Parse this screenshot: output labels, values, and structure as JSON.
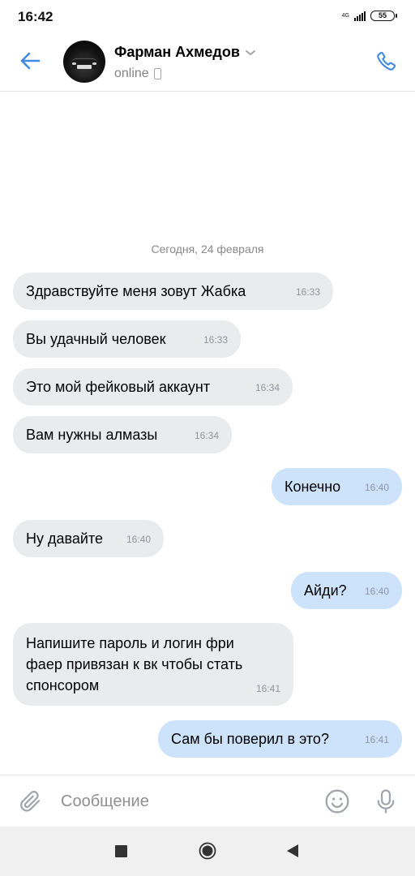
{
  "status_bar": {
    "time": "16:42",
    "network": "4G",
    "battery": "55"
  },
  "header": {
    "contact_name": "Фарман Ахмедов",
    "status": "online"
  },
  "chat": {
    "date_divider": "Сегодня, 24 февраля",
    "messages": [
      {
        "direction": "incoming",
        "text": "Здравствуйте меня зовут Жабка",
        "time": "16:33"
      },
      {
        "direction": "incoming",
        "text": "Вы удачный человек",
        "time": "16:33"
      },
      {
        "direction": "incoming",
        "text": "Это мой фейковый аккаунт",
        "time": "16:34"
      },
      {
        "direction": "incoming",
        "text": "Вам нужны алмазы",
        "time": "16:34"
      },
      {
        "direction": "outgoing",
        "text": "Конечно",
        "time": "16:40"
      },
      {
        "direction": "incoming",
        "text": "Ну давайте",
        "time": "16:40"
      },
      {
        "direction": "outgoing",
        "text": "Айди?",
        "time": "16:40"
      },
      {
        "direction": "incoming",
        "text": "Напишите пароль и логин фри\nфаер привязан к вк чтобы стать\nспонсором",
        "time": "16:41"
      },
      {
        "direction": "outgoing",
        "text": "Сам бы поверил в это?",
        "time": "16:41"
      }
    ]
  },
  "input": {
    "placeholder": "Сообщение",
    "value": ""
  },
  "colors": {
    "accent": "#3f8ae0",
    "incoming_bubble": "#eaebed",
    "outgoing_bubble": "#cde3fb",
    "secondary_text": "#828282"
  },
  "icons": {
    "back": "arrow-left-icon",
    "call": "phone-icon",
    "dropdown": "chevron-down-icon",
    "attach": "paperclip-icon",
    "emoji": "smiley-icon",
    "mic": "microphone-icon"
  }
}
